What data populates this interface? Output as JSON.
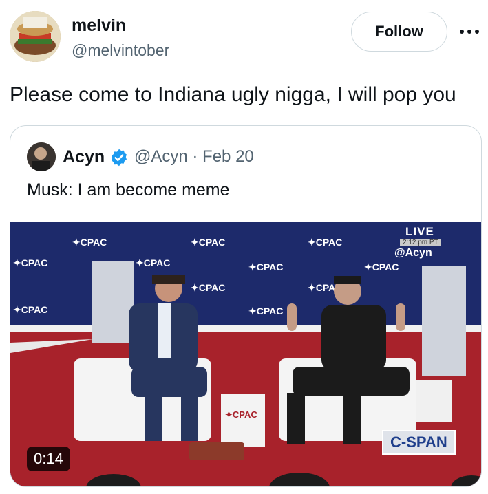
{
  "tweet": {
    "author": {
      "display_name": "melvin",
      "handle": "@melvintober"
    },
    "follow_label": "Follow",
    "more_icon": "more-horizontal-icon",
    "text": "Please come to Indiana ugly nigga, I will pop you"
  },
  "quoted_tweet": {
    "author": {
      "display_name": "Acyn",
      "handle": "@Acyn",
      "date": "· Feb 20",
      "verified": true
    },
    "text": "Musk: I am become meme",
    "video": {
      "duration": "0:14",
      "overlay_live": "LIVE",
      "overlay_time": "2:12 pm PT",
      "overlay_watermark": "@Acyn",
      "broadcaster_logo": "C-SPAN",
      "backdrop_logo_text": "CPAC"
    }
  },
  "colors": {
    "text_primary": "#0f1419",
    "text_secondary": "#536471",
    "border": "#cfd9de",
    "verified_blue": "#1d9bf0",
    "stage_blue": "#1d2a6b",
    "stage_red": "#a8222b"
  }
}
